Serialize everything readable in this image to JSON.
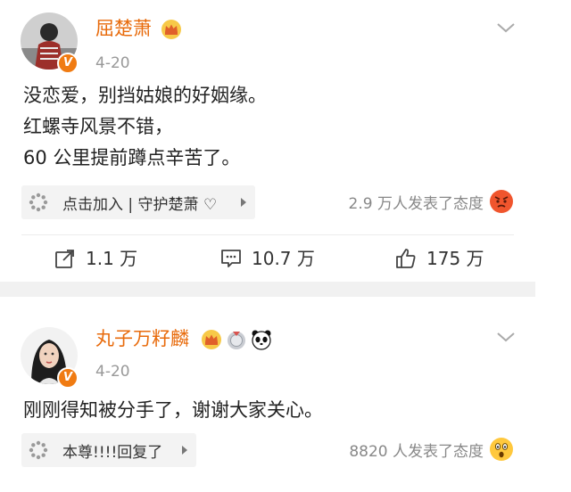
{
  "posts": [
    {
      "author": "屈楚萧",
      "date": "4-20",
      "verified_mark": "V",
      "badges": [
        "crown-badge-icon"
      ],
      "content_lines": [
        "没恋爱，别挡姑娘的好姻缘。",
        "红螺寺风景不错，",
        "60 公里提前蹲点辛苦了。"
      ],
      "tag_label": "点击加入 | 守护楚萧 ♡",
      "reactions_text": "2.9 万人发表了态度",
      "reaction_emoji": "angry-face-icon",
      "actions": {
        "repost": "1.1 万",
        "comment": "10.7 万",
        "like": "175 万"
      }
    },
    {
      "author": "丸子万籽麟",
      "date": "4-20",
      "verified_mark": "V",
      "badges": [
        "crown-badge-icon",
        "medal-badge-icon",
        "panda-badge-icon"
      ],
      "content_lines": [
        "刚刚得知被分手了，谢谢大家关心。"
      ],
      "tag_label": "本尊!!!!回复了",
      "reactions_text": "8820 人发表了态度",
      "reaction_emoji": "surprised-face-icon"
    }
  ],
  "colors": {
    "author": "#e86b0c",
    "verified": "#f07b12",
    "separator": "#f1f1f1",
    "muted": "#999999"
  }
}
